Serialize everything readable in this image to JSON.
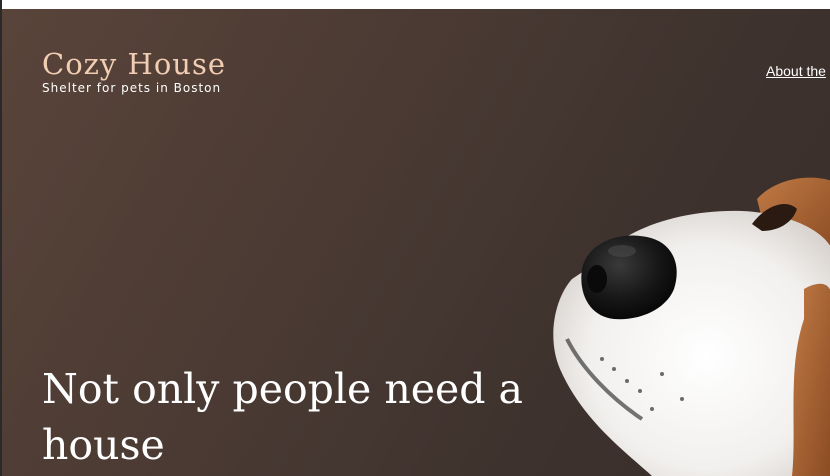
{
  "header": {
    "logo_title": "Cozy House",
    "logo_subtitle": "Shelter for pets in Boston",
    "nav_items": [
      "About the"
    ]
  },
  "hero": {
    "headline": "Not only people need a house",
    "image": "dog-nose-photo"
  },
  "colors": {
    "accent": "#f1cdb3",
    "hero_background": "#4a3a33",
    "text_light": "#ffffff"
  }
}
